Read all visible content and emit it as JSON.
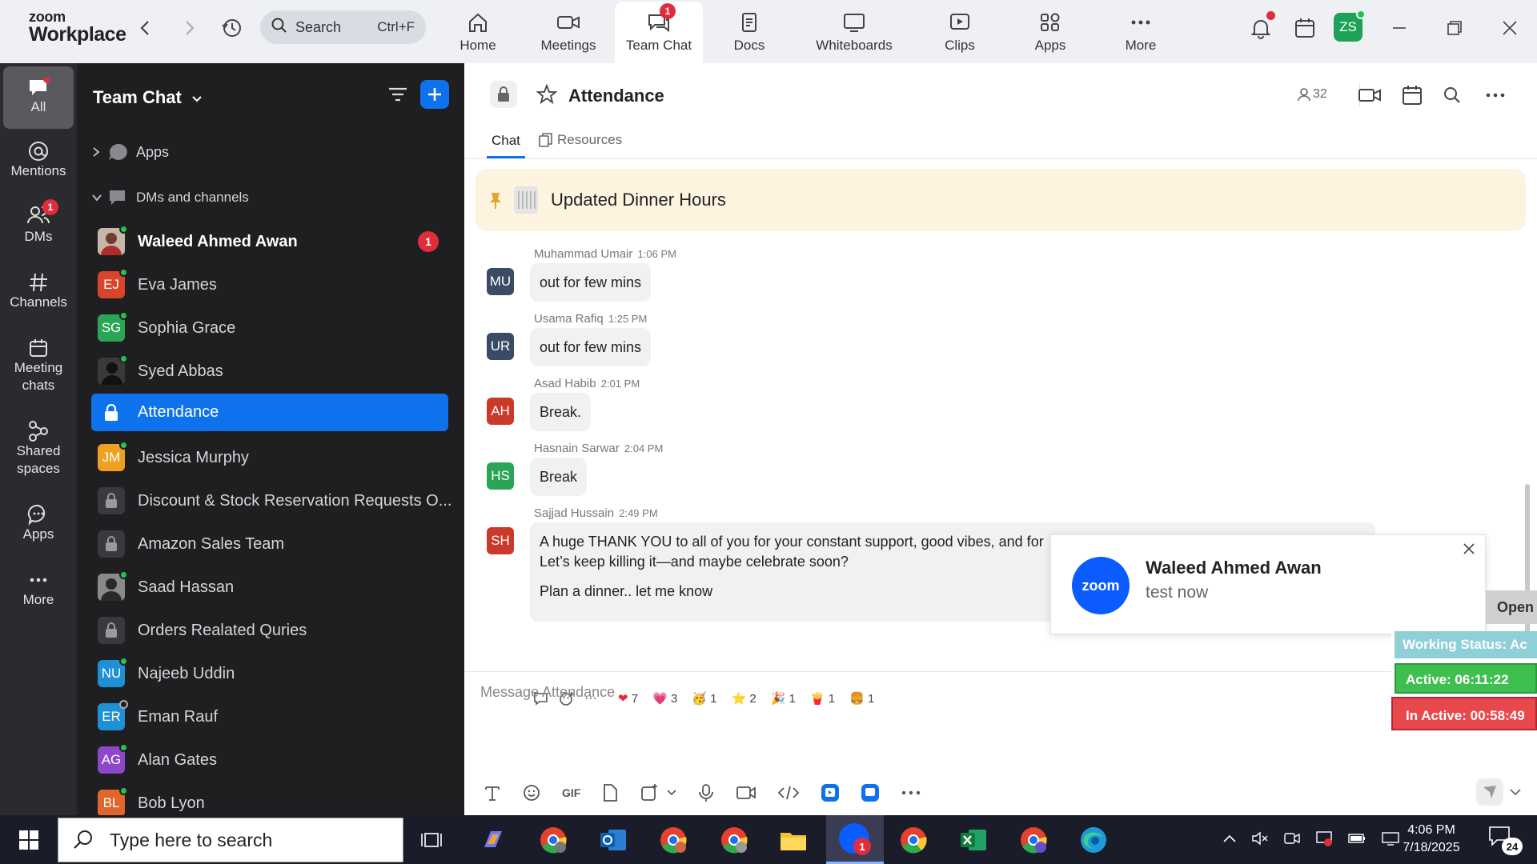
{
  "topbar": {
    "logo_line1": "zoom",
    "logo_line2": "Workplace",
    "search_placeholder": "Search",
    "search_shortcut": "Ctrl+F",
    "nav": [
      {
        "label": "Home",
        "icon": "home-icon"
      },
      {
        "label": "Meetings",
        "icon": "video-camera-icon"
      },
      {
        "label": "Team Chat",
        "icon": "chat-icon",
        "badge": "1",
        "active": true
      },
      {
        "label": "Docs",
        "icon": "document-icon"
      },
      {
        "label": "Whiteboards",
        "icon": "whiteboard-icon"
      },
      {
        "label": "Clips",
        "icon": "clips-icon"
      },
      {
        "label": "Apps",
        "icon": "apps-icon"
      },
      {
        "label": "More",
        "icon": "more-dots-icon"
      }
    ],
    "avatar_initials": "ZS"
  },
  "rail": [
    {
      "label": "All",
      "icon": "chat-bubble-icon"
    },
    {
      "label": "Mentions",
      "icon": "at-icon"
    },
    {
      "label": "DMs",
      "icon": "people-icon",
      "badge": "1"
    },
    {
      "label": "Channels",
      "icon": "hash-icon"
    },
    {
      "label": "Meeting chats",
      "icon": "calendar-icon"
    },
    {
      "label": "Shared spaces",
      "icon": "shared-icon"
    },
    {
      "label": "Apps",
      "icon": "apps-chat-icon"
    },
    {
      "label": "More",
      "icon": "more-dots-icon"
    }
  ],
  "sidebar": {
    "title": "Team Chat",
    "apps_label": "Apps",
    "section_label": "DMs and channels",
    "items": [
      {
        "name": "Waleed Ahmed Awan",
        "type": "photo",
        "bold": true,
        "badge": "1",
        "status": "online"
      },
      {
        "name": "Eva James",
        "initials": "EJ",
        "color": "#d9442b",
        "status": "online"
      },
      {
        "name": "Sophia Grace",
        "initials": "SG",
        "color": "#2aa556",
        "status": "online"
      },
      {
        "name": "Syed Abbas",
        "type": "photo",
        "status": "online"
      },
      {
        "name": "Attendance",
        "type": "lock",
        "selected": true
      },
      {
        "name": "Jessica Murphy",
        "initials": "JM",
        "color": "#f0a020",
        "status": "online"
      },
      {
        "name": "Discount & Stock Reservation Requests O...",
        "type": "lock"
      },
      {
        "name": "Amazon Sales Team",
        "type": "lock"
      },
      {
        "name": "Saad Hassan",
        "type": "photo",
        "status": "online"
      },
      {
        "name": "Orders Realated Quries",
        "type": "lock"
      },
      {
        "name": "Najeeb Uddin",
        "initials": "NU",
        "color": "#1f8fd6",
        "status": "online"
      },
      {
        "name": "Eman Rauf",
        "initials": "ER",
        "color": "#1f8fd6",
        "status": "offline"
      },
      {
        "name": "Alan Gates",
        "initials": "AG",
        "color": "#8f47c9",
        "status": "online"
      },
      {
        "name": "Bob Lyon",
        "initials": "BL",
        "color": "#e0662b",
        "status": "online"
      }
    ]
  },
  "channel": {
    "name": "Attendance",
    "member_count": "32",
    "tabs": [
      "Chat",
      "Resources"
    ],
    "pinned": "Updated Dinner Hours",
    "composer_placeholder": "Message Attendance"
  },
  "messages": [
    {
      "initials": "MU",
      "color": "#3a4b66",
      "sender": "Muhammad Umair",
      "time": "1:06 PM",
      "text": "out for few mins"
    },
    {
      "initials": "UR",
      "color": "#3a4b66",
      "sender": "Usama Rafiq",
      "time": "1:25 PM",
      "text": "out for few mins"
    },
    {
      "initials": "AH",
      "color": "#c93a2b",
      "sender": "Asad Habib",
      "time": "2:01 PM",
      "text": "Break."
    },
    {
      "initials": "HS",
      "color": "#2aa556",
      "sender": "Hasnain Sarwar",
      "time": "2:04 PM",
      "text": "Break"
    },
    {
      "initials": "SH",
      "color": "#c93a2b",
      "sender": "Sajjad Hussain",
      "time": "2:49 PM",
      "line1": "A huge THANK YOU to all of you for your constant support, good vibes, and for",
      "line2": "Let’s keep killing it—and maybe celebrate soon?",
      "line3": "Plan a dinner.. let me know"
    }
  ],
  "reactions": [
    {
      "emoji": "❤",
      "count": "7"
    },
    {
      "emoji": "💗",
      "count": "3"
    },
    {
      "emoji": "🥳",
      "count": "1"
    },
    {
      "emoji": "⭐",
      "count": "2"
    },
    {
      "emoji": "🎉",
      "count": "1"
    },
    {
      "emoji": "🍟",
      "count": "1"
    },
    {
      "emoji": "🍔",
      "count": "1"
    }
  ],
  "notification": {
    "logo": "zoom",
    "title": "Waleed Ahmed Awan",
    "body": "test now"
  },
  "status_widget": {
    "open": "Open",
    "working": "Working Status: Ac",
    "active": "Active: 06:11:22",
    "inactive": "In Active: 00:58:49",
    "colors": {
      "working": "#8fd0d8",
      "active": "#3fbf4f",
      "inactive": "#e8474b"
    }
  },
  "taskbar": {
    "search_placeholder": "Type here to search",
    "time": "4:06 PM",
    "date": "7/18/2025",
    "notif_count": "24",
    "zoom_badge": "1"
  }
}
